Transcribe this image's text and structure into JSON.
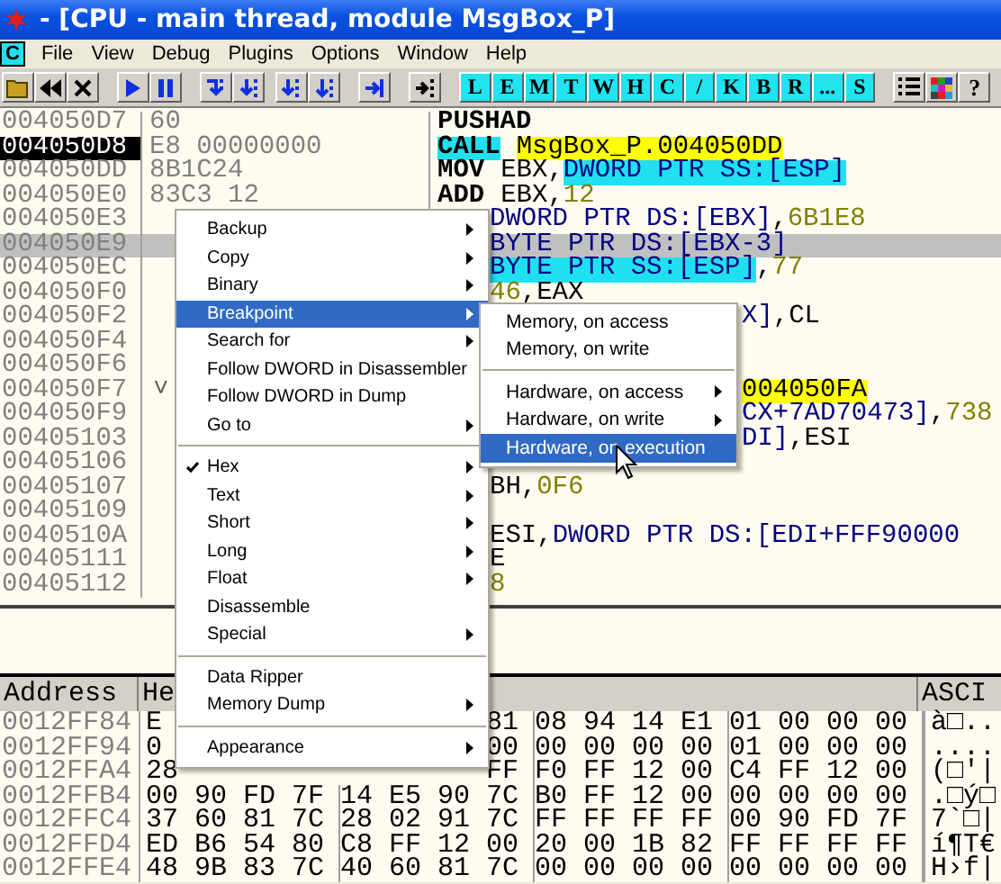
{
  "title_bar": {
    "title": "- [CPU - main thread, module MsgBox_P]"
  },
  "menu_bar": {
    "icon_letter": "C",
    "items": [
      "File",
      "View",
      "Debug",
      "Plugins",
      "Options",
      "Window",
      "Help"
    ]
  },
  "toolbar": {
    "letter_buttons": [
      "L",
      "E",
      "M",
      "T",
      "W",
      "H",
      "C",
      "/",
      "K",
      "B",
      "R",
      "...",
      "S"
    ],
    "help_button": "?"
  },
  "disassembly": {
    "rows": [
      {
        "address": "004050D7",
        "hex": "60",
        "kind": "full",
        "selected": false,
        "highlighted": false,
        "mnemonic": {
          "text": "PUSHAD",
          "kind": "plain"
        }
      },
      {
        "address": "004050D8",
        "hex": "E8 00000000",
        "kind": "full",
        "selected": true,
        "highlighted": false,
        "mnemonic": {
          "text": "CALL",
          "kind": "call"
        },
        "operands": [
          {
            "text": "MsgBox_P.004050DD",
            "kind": "jump"
          }
        ]
      },
      {
        "address": "004050DD",
        "hex": "8B1C24",
        "kind": "full",
        "selected": false,
        "highlighted": false,
        "mnemonic": {
          "text": "MOV",
          "kind": "plain"
        },
        "operands": [
          {
            "text": "EBX,",
            "kind": "plain"
          },
          {
            "text": "DWORD PTR SS:[ESP]",
            "kind": "stack"
          }
        ]
      },
      {
        "address": "004050E0",
        "hex": "83C3 12",
        "kind": "full",
        "selected": false,
        "highlighted": false,
        "mnemonic": {
          "text": "ADD",
          "kind": "plain"
        },
        "operands": [
          {
            "text": "EBX,",
            "kind": "plain"
          },
          {
            "text": "12",
            "kind": "imm"
          }
        ]
      },
      {
        "address": "004050E3",
        "kind": "after_menu",
        "selected": false,
        "highlighted": false,
        "operands": [
          {
            "text": "DWORD PTR DS:[EBX]",
            "kind": "mem"
          },
          {
            "text": ",",
            "kind": "plain"
          },
          {
            "text": "6B1E8",
            "kind": "imm"
          }
        ]
      },
      {
        "address": "004050E9",
        "kind": "after_menu",
        "selected": false,
        "highlighted": true,
        "operands": [
          {
            "text": "BYTE PTR DS:[EBX-3]",
            "kind": "mem"
          }
        ]
      },
      {
        "address": "004050EC",
        "kind": "after_menu",
        "selected": false,
        "highlighted": false,
        "operands": [
          {
            "text": "BYTE PTR SS:[ESP]",
            "kind": "stack"
          },
          {
            "text": ",",
            "kind": "plain"
          },
          {
            "text": "77",
            "kind": "imm"
          }
        ]
      },
      {
        "address": "004050F0",
        "kind": "after_menu",
        "selected": false,
        "highlighted": false,
        "operands": [
          {
            "text": "46",
            "kind": "imm"
          },
          {
            "text": ",EAX",
            "kind": "plain"
          }
        ]
      },
      {
        "address": "004050F2",
        "kind": "after_submenu",
        "selected": false,
        "highlighted": false,
        "operands": [
          {
            "text": "X]",
            "kind": "mem"
          },
          {
            "text": ",CL",
            "kind": "plain"
          }
        ]
      },
      {
        "address": "004050F4",
        "kind": "after_submenu",
        "selected": false,
        "highlighted": false
      },
      {
        "address": "004050F6",
        "kind": "after_submenu",
        "selected": false,
        "highlighted": false
      },
      {
        "address": "004050F7",
        "hex_mark": "˅",
        "kind": "after_submenu",
        "selected": false,
        "highlighted": false,
        "operands": [
          {
            "text": "004050FA",
            "kind": "jump"
          }
        ]
      },
      {
        "address": "004050F9",
        "kind": "after_submenu",
        "selected": false,
        "highlighted": false,
        "operands": [
          {
            "text": "CX+7AD70473]",
            "kind": "mem"
          },
          {
            "text": ",",
            "kind": "plain"
          },
          {
            "text": "738",
            "kind": "imm"
          }
        ]
      },
      {
        "address": "00405103",
        "kind": "after_submenu",
        "selected": false,
        "highlighted": false,
        "operands": [
          {
            "text": "DI]",
            "kind": "mem"
          },
          {
            "text": ",ESI",
            "kind": "plain"
          }
        ]
      },
      {
        "address": "00405106",
        "kind": "after_menu",
        "selected": false,
        "highlighted": false
      },
      {
        "address": "00405107",
        "kind": "after_menu",
        "selected": false,
        "highlighted": false,
        "operands": [
          {
            "text": "BH,",
            "kind": "plain"
          },
          {
            "text": "0F6",
            "kind": "imm"
          }
        ]
      },
      {
        "address": "00405109",
        "kind": "after_menu",
        "selected": false,
        "highlighted": false
      },
      {
        "address": "0040510A",
        "kind": "after_menu",
        "selected": false,
        "highlighted": false,
        "operands": [
          {
            "text": "ESI,",
            "kind": "plain"
          },
          {
            "text": "DWORD PTR DS:[EDI+FFF90000",
            "kind": "mem"
          }
        ]
      },
      {
        "address": "00405111",
        "kind": "after_menu",
        "selected": false,
        "highlighted": false,
        "operands": [
          {
            "text": "E",
            "kind": "plain"
          }
        ]
      },
      {
        "address": "00405112",
        "kind": "after_menu",
        "selected": false,
        "highlighted": false,
        "operands": [
          {
            "text": "8",
            "kind": "imm"
          }
        ]
      }
    ]
  },
  "dump": {
    "columns": [
      "Address",
      "He",
      "ASCI"
    ],
    "rows": [
      {
        "address": "0012FF84",
        "bytes": [
          "E"
        ],
        "bytes_tail": [
          "81",
          "08",
          "94",
          "14",
          "E1",
          "01",
          "00",
          "00",
          "00"
        ],
        "ascii": "à□.."
      },
      {
        "address": "0012FF94",
        "bytes": [
          "0"
        ],
        "bytes_tail": [
          "00",
          "00",
          "00",
          "00",
          "00",
          "01",
          "00",
          "00",
          "00"
        ],
        "ascii": "...."
      },
      {
        "address": "0012FFA4",
        "bytes": [
          "28"
        ],
        "bytes_tail": [
          "FF",
          "F0",
          "FF",
          "12",
          "00",
          "C4",
          "FF",
          "12",
          "00"
        ],
        "ascii": "(□'|"
      },
      {
        "address": "0012FFB4",
        "bytes": [
          "00",
          "90",
          "FD",
          "7F",
          "14",
          "E5",
          "90",
          "7C",
          "B0",
          "FF",
          "12",
          "00",
          "00",
          "00",
          "00",
          "00"
        ],
        "ascii": ".□ý□"
      },
      {
        "address": "0012FFC4",
        "bytes": [
          "37",
          "60",
          "81",
          "7C",
          "28",
          "02",
          "91",
          "7C",
          "FF",
          "FF",
          "FF",
          "FF",
          "00",
          "90",
          "FD",
          "7F"
        ],
        "ascii": "7`□|"
      },
      {
        "address": "0012FFD4",
        "bytes": [
          "ED",
          "B6",
          "54",
          "80",
          "C8",
          "FF",
          "12",
          "00",
          "20",
          "00",
          "1B",
          "82",
          "FF",
          "FF",
          "FF",
          "FF"
        ],
        "ascii": "í¶T€"
      },
      {
        "address": "0012FFE4",
        "bytes": [
          "48",
          "9B",
          "83",
          "7C",
          "40",
          "60",
          "81",
          "7C",
          "00",
          "00",
          "00",
          "00",
          "00",
          "00",
          "00",
          "00"
        ],
        "ascii": "H›f|"
      }
    ]
  },
  "context_menu": {
    "items": [
      {
        "kind": "item",
        "label": "Backup",
        "selected": false,
        "checked": false,
        "has_submenu": true
      },
      {
        "kind": "item",
        "label": "Copy",
        "selected": false,
        "checked": false,
        "has_submenu": true
      },
      {
        "kind": "item",
        "label": "Binary",
        "selected": false,
        "checked": false,
        "has_submenu": true
      },
      {
        "kind": "item",
        "label": "Breakpoint",
        "selected": true,
        "checked": false,
        "has_submenu": true
      },
      {
        "kind": "item",
        "label": "Search for",
        "selected": false,
        "checked": false,
        "has_submenu": true
      },
      {
        "kind": "item",
        "label": "Follow DWORD in Disassembler",
        "selected": false,
        "checked": false,
        "has_submenu": false
      },
      {
        "kind": "item",
        "label": "Follow DWORD in Dump",
        "selected": false,
        "checked": false,
        "has_submenu": false
      },
      {
        "kind": "item",
        "label": "Go to",
        "selected": false,
        "checked": false,
        "has_submenu": true
      },
      {
        "kind": "separator"
      },
      {
        "kind": "item",
        "label": "Hex",
        "selected": false,
        "checked": true,
        "has_submenu": true
      },
      {
        "kind": "item",
        "label": "Text",
        "selected": false,
        "checked": false,
        "has_submenu": true
      },
      {
        "kind": "item",
        "label": "Short",
        "selected": false,
        "checked": false,
        "has_submenu": true
      },
      {
        "kind": "item",
        "label": "Long",
        "selected": false,
        "checked": false,
        "has_submenu": true
      },
      {
        "kind": "item",
        "label": "Float",
        "selected": false,
        "checked": false,
        "has_submenu": true
      },
      {
        "kind": "item",
        "label": "Disassemble",
        "selected": false,
        "checked": false,
        "has_submenu": false
      },
      {
        "kind": "item",
        "label": "Special",
        "selected": false,
        "checked": false,
        "has_submenu": true
      },
      {
        "kind": "separator"
      },
      {
        "kind": "item",
        "label": "Data Ripper",
        "selected": false,
        "checked": false,
        "has_submenu": false
      },
      {
        "kind": "item",
        "label": "Memory Dump",
        "selected": false,
        "checked": false,
        "has_submenu": true
      },
      {
        "kind": "separator"
      },
      {
        "kind": "item",
        "label": "Appearance",
        "selected": false,
        "checked": false,
        "has_submenu": true
      }
    ]
  },
  "submenu": {
    "items": [
      {
        "kind": "item",
        "label": "Memory, on access",
        "selected": false,
        "has_submenu": false
      },
      {
        "kind": "item",
        "label": "Memory, on write",
        "selected": false,
        "has_submenu": false
      },
      {
        "kind": "separator"
      },
      {
        "kind": "item",
        "label": "Hardware, on access",
        "selected": false,
        "has_submenu": true
      },
      {
        "kind": "item",
        "label": "Hardware, on write",
        "selected": false,
        "has_submenu": true
      },
      {
        "kind": "item",
        "label": "Hardware, on execution",
        "selected": true,
        "has_submenu": false
      }
    ]
  }
}
